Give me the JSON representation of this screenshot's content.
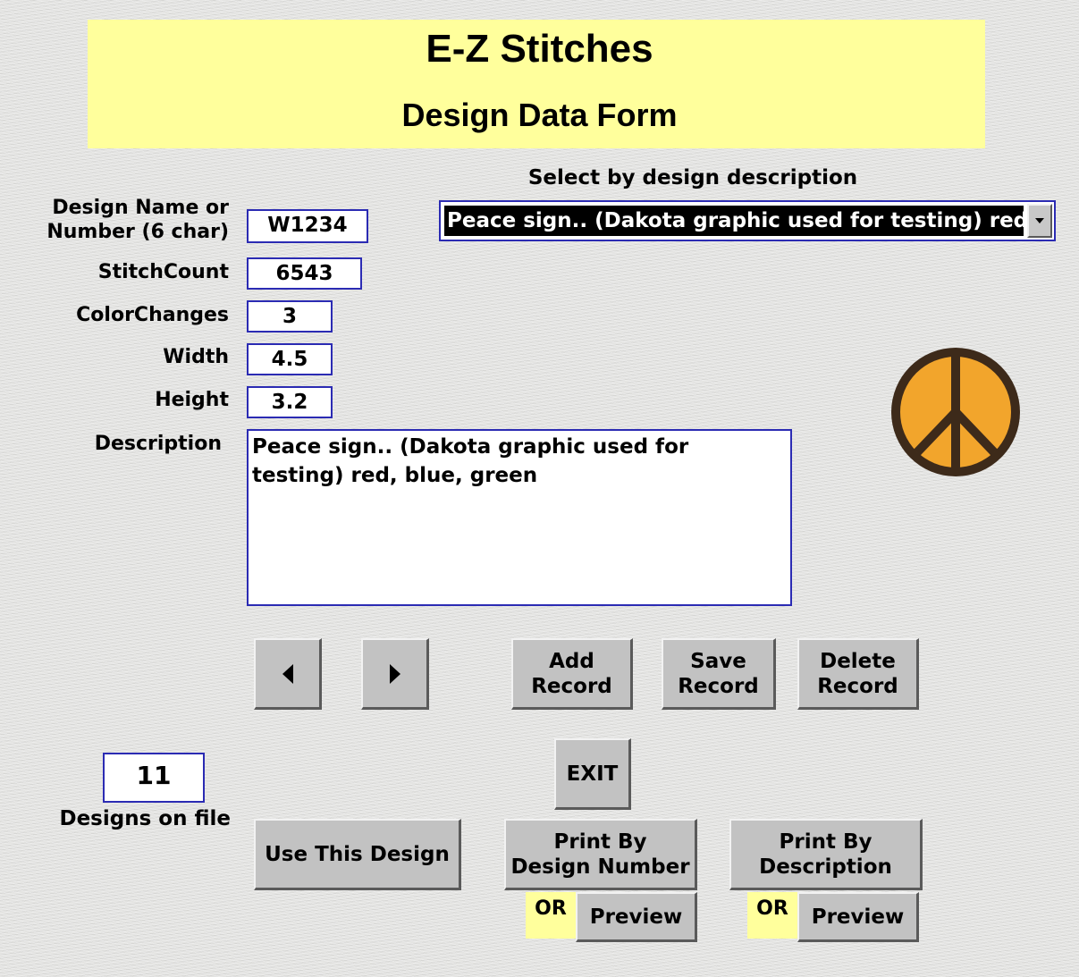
{
  "header": {
    "app_title": "E-Z Stitches",
    "form_title": "Design Data Form"
  },
  "selector": {
    "label": "Select by design description",
    "selected_value": "Peace sign.. (Dakota graphic used for testing)  red, blue, green"
  },
  "fields": {
    "design_name": {
      "label_line1": "Design Name or",
      "label_line2": "Number (6 char)",
      "value": "W1234"
    },
    "stitch_count": {
      "label": "StitchCount",
      "value": "6543"
    },
    "color_changes": {
      "label": "ColorChanges",
      "value": "3"
    },
    "width": {
      "label": "Width",
      "value": "4.5"
    },
    "height": {
      "label": "Height",
      "value": "3.2"
    },
    "description": {
      "label": "Description",
      "value": "Peace sign.. (Dakota graphic used for testing)  red, blue, green"
    }
  },
  "buttons": {
    "add_line1": "Add",
    "add_line2": "Record",
    "save_line1": "Save",
    "save_line2": "Record",
    "delete_line1": "Delete",
    "delete_line2": "Record",
    "exit": "EXIT",
    "use_design": "Use This Design",
    "print_number_line1": "Print By",
    "print_number_line2": "Design Number",
    "print_desc_line1": "Print By",
    "print_desc_line2": "Description",
    "preview": "Preview",
    "or": "OR"
  },
  "counter": {
    "value": "11",
    "label": "Designs on file"
  },
  "image": {
    "icon": "peace-sign-icon",
    "fill_color": "#f2a52c",
    "stroke_color": "#3d2a1a"
  },
  "colors": {
    "banner": "#ffff9c",
    "field_border": "#2b2bb3",
    "button_face": "#c2c2c2"
  }
}
